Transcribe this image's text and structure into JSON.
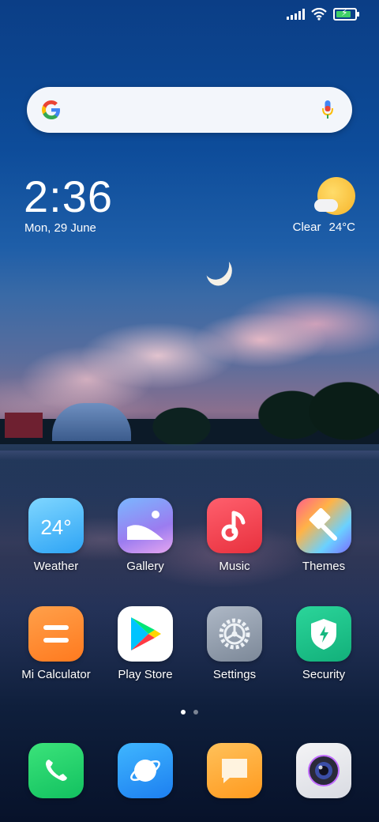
{
  "status_bar": {
    "icons": [
      "signal-icon",
      "wifi-icon",
      "battery-charging-icon"
    ],
    "battery_level_percent": 80
  },
  "search": {
    "logo": "G",
    "mic_icon": "mic-icon"
  },
  "clock": {
    "time": "2:36",
    "date": "Mon, 29 June"
  },
  "weather_widget": {
    "condition": "Clear",
    "temperature": "24°C",
    "icon": "sun-cloud-icon"
  },
  "apps": [
    {
      "label": "Weather",
      "icon": "weather-icon",
      "icon_text": "24°"
    },
    {
      "label": "Gallery",
      "icon": "gallery-icon"
    },
    {
      "label": "Music",
      "icon": "music-note-icon"
    },
    {
      "label": "Themes",
      "icon": "themes-brush-icon"
    },
    {
      "label": "Mi Calculator",
      "icon": "calculator-icon"
    },
    {
      "label": "Play Store",
      "icon": "play-store-icon"
    },
    {
      "label": "Settings",
      "icon": "settings-gear-icon"
    },
    {
      "label": "Security",
      "icon": "security-shield-icon"
    }
  ],
  "page_indicator": {
    "pages": 2,
    "active": 1
  },
  "dock": [
    {
      "icon": "phone-icon"
    },
    {
      "icon": "browser-icon"
    },
    {
      "icon": "messages-icon"
    },
    {
      "icon": "camera-icon"
    }
  ]
}
